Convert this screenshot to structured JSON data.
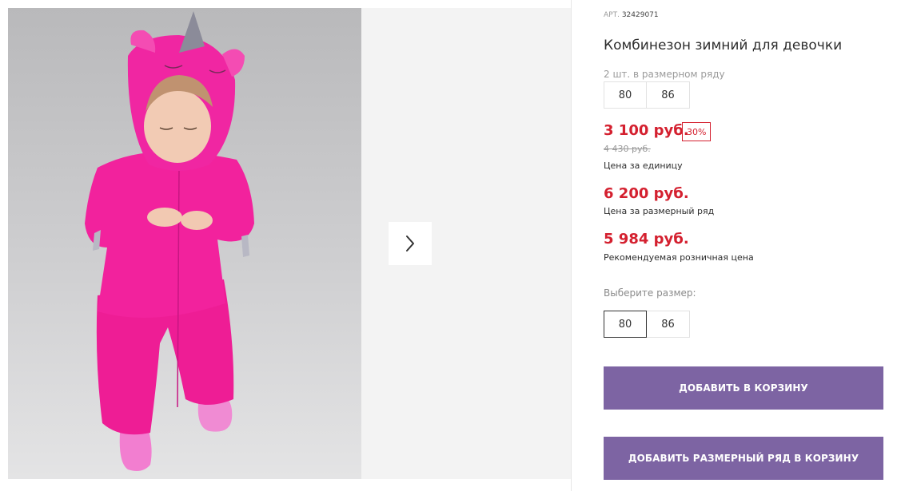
{
  "gallery": {
    "next_icon": "chevron-right-icon"
  },
  "product": {
    "art_label": "АРТ.",
    "art_number": "32429071",
    "title": "Комбинезон зимний для девочки",
    "range_note": "2 шт. в размерном ряду",
    "range_sizes": [
      "80",
      "86"
    ],
    "price_unit": "3 100 руб.",
    "discount": "30%",
    "old_price": "4 430 руб.",
    "price_unit_caption": "Цена за единицу",
    "price_range": "6 200 руб.",
    "price_range_caption": "Цена за размерный ряд",
    "price_retail": "5 984 руб.",
    "price_retail_caption": "Рекомендуемая розничная цена",
    "choose_label": "Выберите размер:",
    "size_options": [
      "80",
      "86"
    ],
    "selected_size": "80"
  },
  "actions": {
    "add_to_cart": "ДОБАВИТЬ В КОРЗИНУ",
    "add_range_to_cart": "ДОБАВИТЬ РАЗМЕРНЫЙ РЯД В КОРЗИНУ"
  },
  "colors": {
    "price_red": "#d4202f",
    "button_purple": "#7d64a3",
    "product_pink": "#f0209a"
  }
}
